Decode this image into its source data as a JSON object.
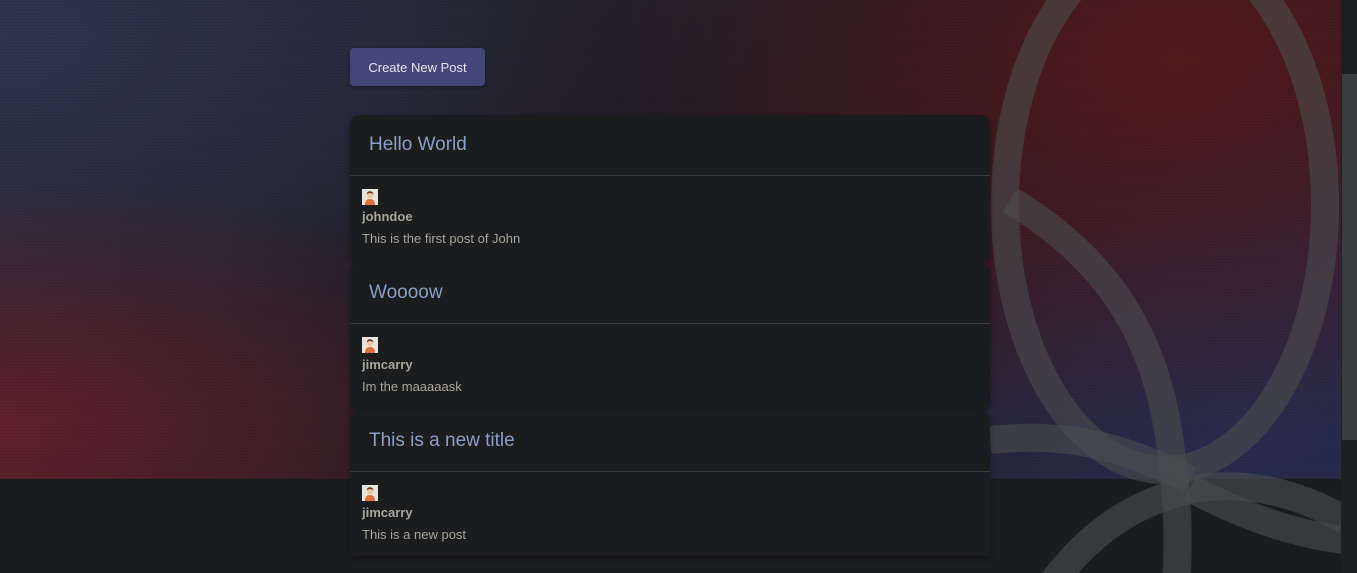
{
  "toolbar": {
    "create_label": "Create New Post"
  },
  "posts": [
    {
      "title": "Hello World",
      "author": "johndoe",
      "content": "This is the first post of John"
    },
    {
      "title": "Woooow",
      "author": "jimcarry",
      "content": "Im the maaaaask"
    },
    {
      "title": "This is a new title",
      "author": "jimcarry",
      "content": "This is a new post"
    }
  ],
  "colors": {
    "button_bg": "#44467a",
    "title_color": "#8a9fc4",
    "card_bg": "#1b1c1e",
    "page_bg": "#1b1c1e",
    "muted_text": "#a9a49a"
  },
  "icons": {
    "avatar": "user-avatar-icon"
  }
}
